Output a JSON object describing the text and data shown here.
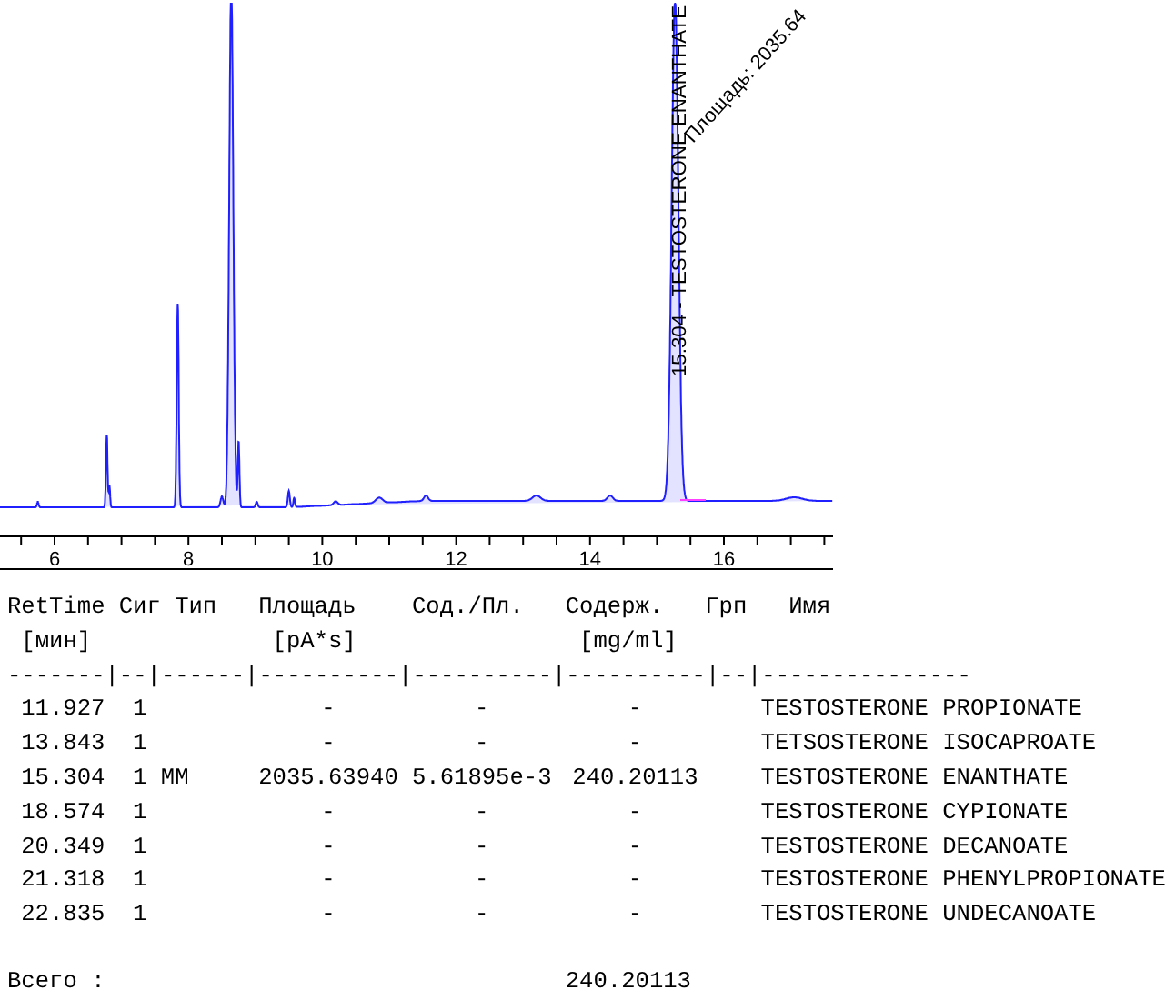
{
  "chromatogram": {
    "x_ticks": [
      "6",
      "8",
      "10",
      "12",
      "14",
      "16"
    ],
    "peak_label": "15.304 - TESTOSTERONE ENANTHATE",
    "area_label": "Площадь: 2035.64"
  },
  "report": {
    "headers": [
      "RetTime",
      "Сиг",
      "Тип",
      "Площадь",
      "Сод./Пл.",
      "Содерж.",
      "Грп",
      "Имя"
    ],
    "units": [
      "[мин]",
      "[pA*s]",
      "[mg/ml]"
    ],
    "separator": "-------|--|------|----------|----------|----------|--|---------------",
    "rows": [
      {
        "ret_time": "11.927",
        "signal": "1",
        "area": "-",
        "amount_per_area": "-",
        "amount": "-",
        "name": "TESTOSTERONE PROPIONATE"
      },
      {
        "ret_time": "13.843",
        "signal": "1",
        "area": "-",
        "amount_per_area": "-",
        "amount": "-",
        "name": "TETSOSTERONE ISOCAPROATE"
      },
      {
        "ret_time": "15.304",
        "signal": "1",
        "type": "MM",
        "area": "2035.63940",
        "amount_per_area": "5.61895e-3",
        "amount": "240.20113",
        "name": "TESTOSTERONE ENANTHATE"
      },
      {
        "ret_time": "18.574",
        "signal": "1",
        "area": "-",
        "amount_per_area": "-",
        "amount": "-",
        "name": "TESTOSTERONE CYPIONATE"
      },
      {
        "ret_time": "20.349",
        "signal": "1",
        "area": "-",
        "amount_per_area": "-",
        "amount": "-",
        "name": "TESTOSTERONE DECANOATE"
      },
      {
        "ret_time": "21.318",
        "signal": "1",
        "area": "-",
        "amount_per_area": "-",
        "amount": "-",
        "name": "TESTOSTERONE PHENYLPROPIONATE"
      },
      {
        "ret_time": "22.835",
        "signal": "1",
        "area": "-",
        "amount_per_area": "-",
        "amount": "-",
        "name": "TESTOSTERONE UNDECANOATE"
      }
    ],
    "total": {
      "label": "Всего :",
      "amount": "240.20113"
    }
  }
}
